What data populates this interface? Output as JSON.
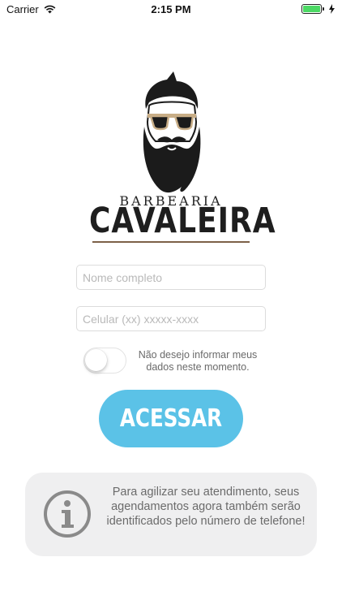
{
  "status_bar": {
    "carrier": "Carrier",
    "time": "2:15 PM",
    "battery_color": "#4cd964"
  },
  "logo": {
    "line1": "BARBEARIA",
    "line2": "CAVALEIRA",
    "icon": "bearded-man-logo-icon"
  },
  "form": {
    "name_placeholder": "Nome completo",
    "phone_placeholder": "Celular (xx) xxxxx-xxxx",
    "toggle_label": "Não desejo informar meus dados neste momento.",
    "toggle_on": false,
    "submit_label": "ACESSAR",
    "accent_color": "#5bc2e7"
  },
  "info": {
    "icon": "info-icon",
    "text": "Para agilizar seu atendimento, seus agendamentos agora também serão identificados pelo número de telefone!"
  }
}
